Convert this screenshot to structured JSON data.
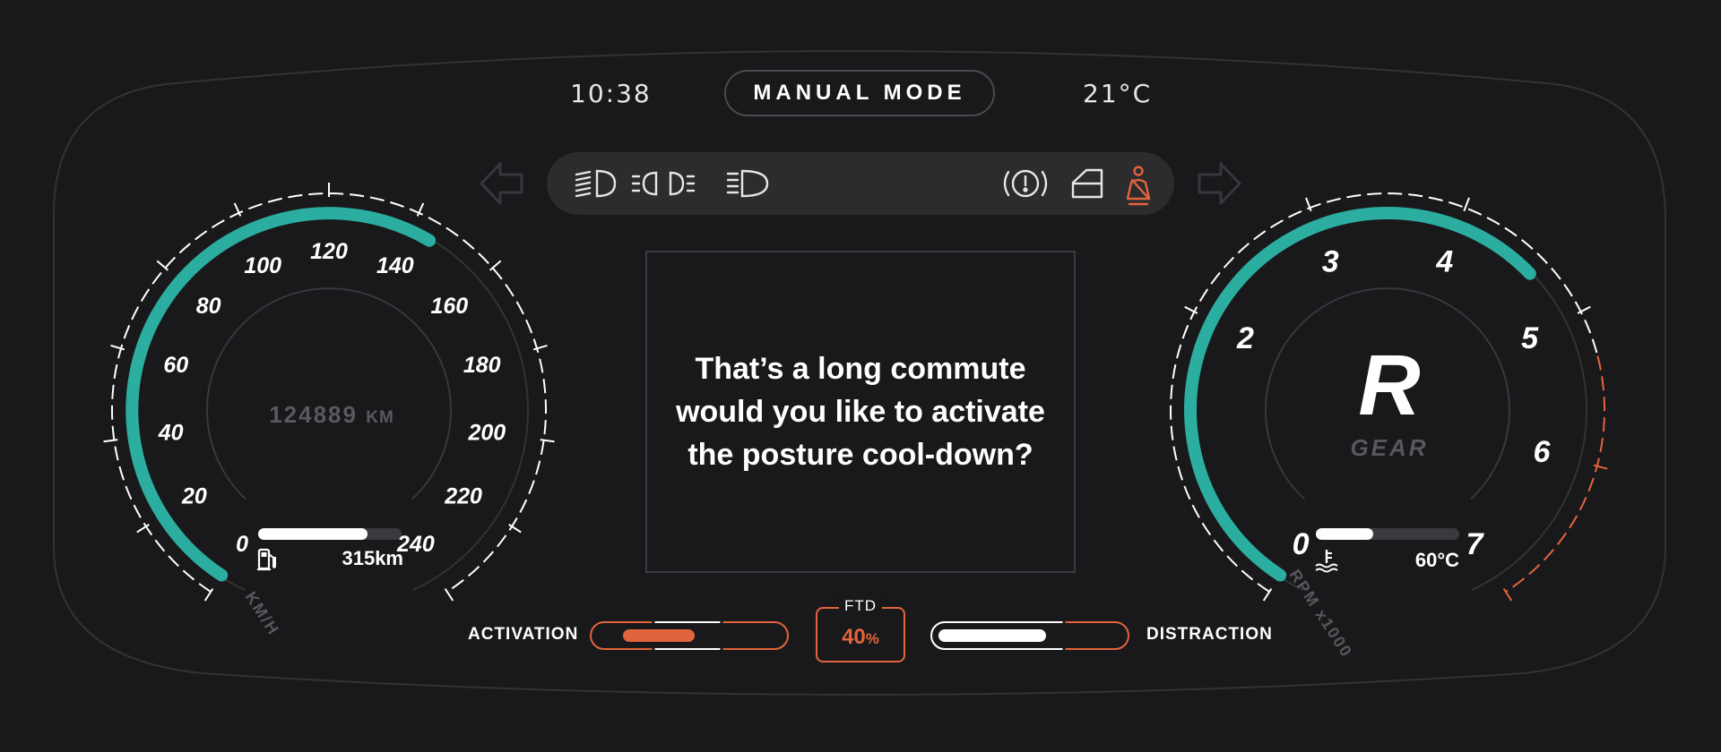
{
  "header": {
    "clock": "10:38",
    "mode_label": "MANUAL MODE",
    "temperature": "21°C"
  },
  "indicators": {
    "left": [
      {
        "icon": "low-beam-headlight-icon",
        "active": true
      },
      {
        "icon": "fog-light-icon",
        "active": true
      },
      {
        "icon": "high-beam-headlight-icon",
        "active": true
      }
    ],
    "right": [
      {
        "icon": "brake-warning-icon",
        "active": true
      },
      {
        "icon": "door-open-icon",
        "active": true
      },
      {
        "icon": "seatbelt-warning-icon",
        "active": true
      }
    ],
    "turn_signals": [
      {
        "icon": "turn-left-arrow-icon",
        "active": false
      },
      {
        "icon": "turn-right-arrow-icon",
        "active": false
      }
    ]
  },
  "speedometer": {
    "ticks": [
      "0",
      "20",
      "40",
      "60",
      "80",
      "100",
      "120",
      "140",
      "160",
      "180",
      "200",
      "220",
      "240"
    ],
    "max": 240,
    "speed_value": 145,
    "unit_label": "KM/H",
    "odometer_value": "124889",
    "odometer_unit": "KM",
    "fuel_fraction": 0.76,
    "range_value": "315km",
    "fuel_icon": "fuel-pump-icon"
  },
  "tachometer": {
    "ticks": [
      "0",
      "2",
      "3",
      "4",
      "5",
      "6",
      "7"
    ],
    "max": 7,
    "rpm_value": 4.6,
    "redline_from": 5.3,
    "unit_label": "RPM x1000",
    "gear_value": "R",
    "gear_label": "GEAR",
    "coolant_fraction": 0.4,
    "coolant_value": "60°C",
    "coolant_icon": "coolant-temperature-icon"
  },
  "message": {
    "lines": [
      "That’s a long commute",
      "would you like to activate",
      "the posture cool-down?"
    ]
  },
  "bottom": {
    "activation_label": "ACTIVATION",
    "ftd_label": "FTD",
    "ftd_value": "40",
    "ftd_unit": "%",
    "distraction_label": "DISTRACTION",
    "activation_fraction": 0.4,
    "distraction_fraction": 0.6
  },
  "colors": {
    "background": "#19191b",
    "accent_teal": "#2bada0",
    "accent_orange": "#e2643c",
    "muted": "#58585c",
    "frame": "#3a3a3e"
  }
}
